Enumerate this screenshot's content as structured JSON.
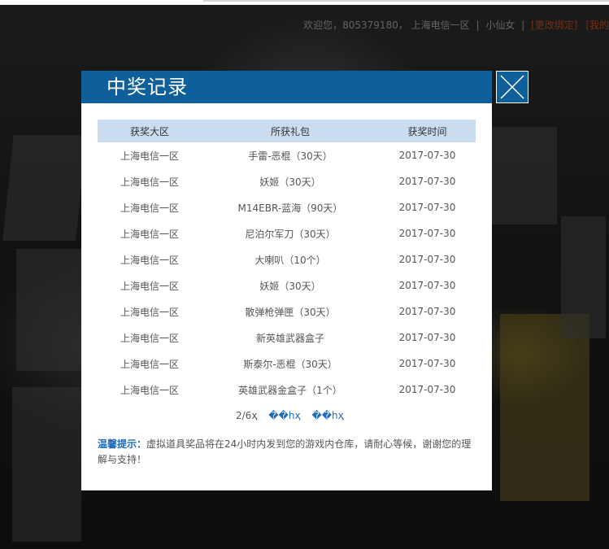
{
  "header": {
    "welcome": "欢迎您，805379180，",
    "server": "上海电信一区",
    "nickname": "小仙女",
    "change_binding": "[更改绑定]",
    "truncated_link": "[我的"
  },
  "modal": {
    "title": "中奖记录",
    "columns": [
      "获奖大区",
      "所获礼包",
      "获奖时间"
    ],
    "rows": [
      [
        "上海电信一区",
        "手雷-恶棍（30天）",
        "2017-07-30"
      ],
      [
        "上海电信一区",
        "妖姬（30天）",
        "2017-07-30"
      ],
      [
        "上海电信一区",
        "M14EBR-蓝海（90天）",
        "2017-07-30"
      ],
      [
        "上海电信一区",
        "尼泊尔军刀（30天）",
        "2017-07-30"
      ],
      [
        "上海电信一区",
        "大喇叭（10个）",
        "2017-07-30"
      ],
      [
        "上海电信一区",
        "妖姬（30天）",
        "2017-07-30"
      ],
      [
        "上海电信一区",
        "散弹枪弹匣（30天）",
        "2017-07-30"
      ],
      [
        "上海电信一区",
        "新英雄武器盒子",
        "2017-07-30"
      ],
      [
        "上海电信一区",
        "斯泰尔-恶棍（30天）",
        "2017-07-30"
      ],
      [
        "上海电信一区",
        "英雄武器金盒子（1个）",
        "2017-07-30"
      ]
    ],
    "pager": {
      "page_info": "2/6ҳ",
      "prev": "��hҳ",
      "next": "��hҳ"
    },
    "tip_label": "温馨提示：",
    "tip_text": "虚拟道具奖品将在24小时内发到您的游戏内仓库，请耐心等候，谢谢您的理解与支持！"
  }
}
